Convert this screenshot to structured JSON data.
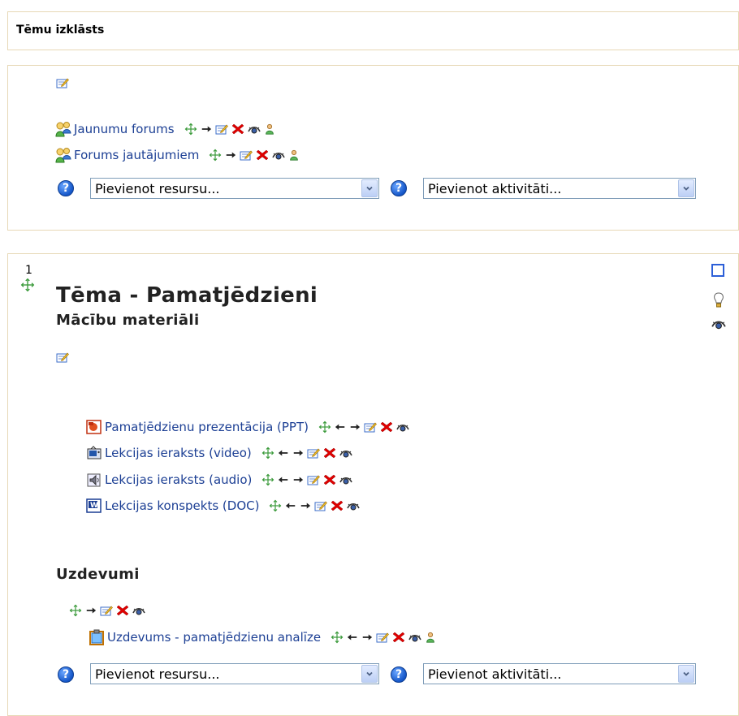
{
  "header": {
    "title": "Tēmu izklāsts"
  },
  "section0": {
    "activities": [
      {
        "label": "Jaunumu forums",
        "type": "forum"
      },
      {
        "label": "Forums jautājumiem",
        "type": "forum"
      }
    ],
    "add_resource": "Pievienot resursu...",
    "add_activity": "Pievienot aktivitāti...",
    "help": "?"
  },
  "section1": {
    "number": "1",
    "title": "Tēma - Pamatjēdzieni",
    "subheading_materials": "Mācību materiāli",
    "materials": [
      {
        "label": "Pamatjēdzienu prezentācija (PPT)",
        "icon": "powerpoint-icon"
      },
      {
        "label": "Lekcijas ieraksts (video)",
        "icon": "video-icon"
      },
      {
        "label": "Lekcijas ieraksts (audio)",
        "icon": "audio-icon"
      },
      {
        "label": "Lekcijas konspekts (DOC)",
        "icon": "word-icon"
      }
    ],
    "subheading_tasks": "Uzdevumi",
    "task": {
      "label": "Uzdevums - pamatjēdzienu analīze",
      "icon": "assignment-icon"
    },
    "add_resource": "Pievienot resursu...",
    "add_activity": "Pievienot aktivitāti...",
    "help": "?"
  },
  "colors": {
    "link": "#1c3f94",
    "border": "#e7d8b5",
    "delete": "#e00000",
    "move": "#3a9a3a"
  }
}
